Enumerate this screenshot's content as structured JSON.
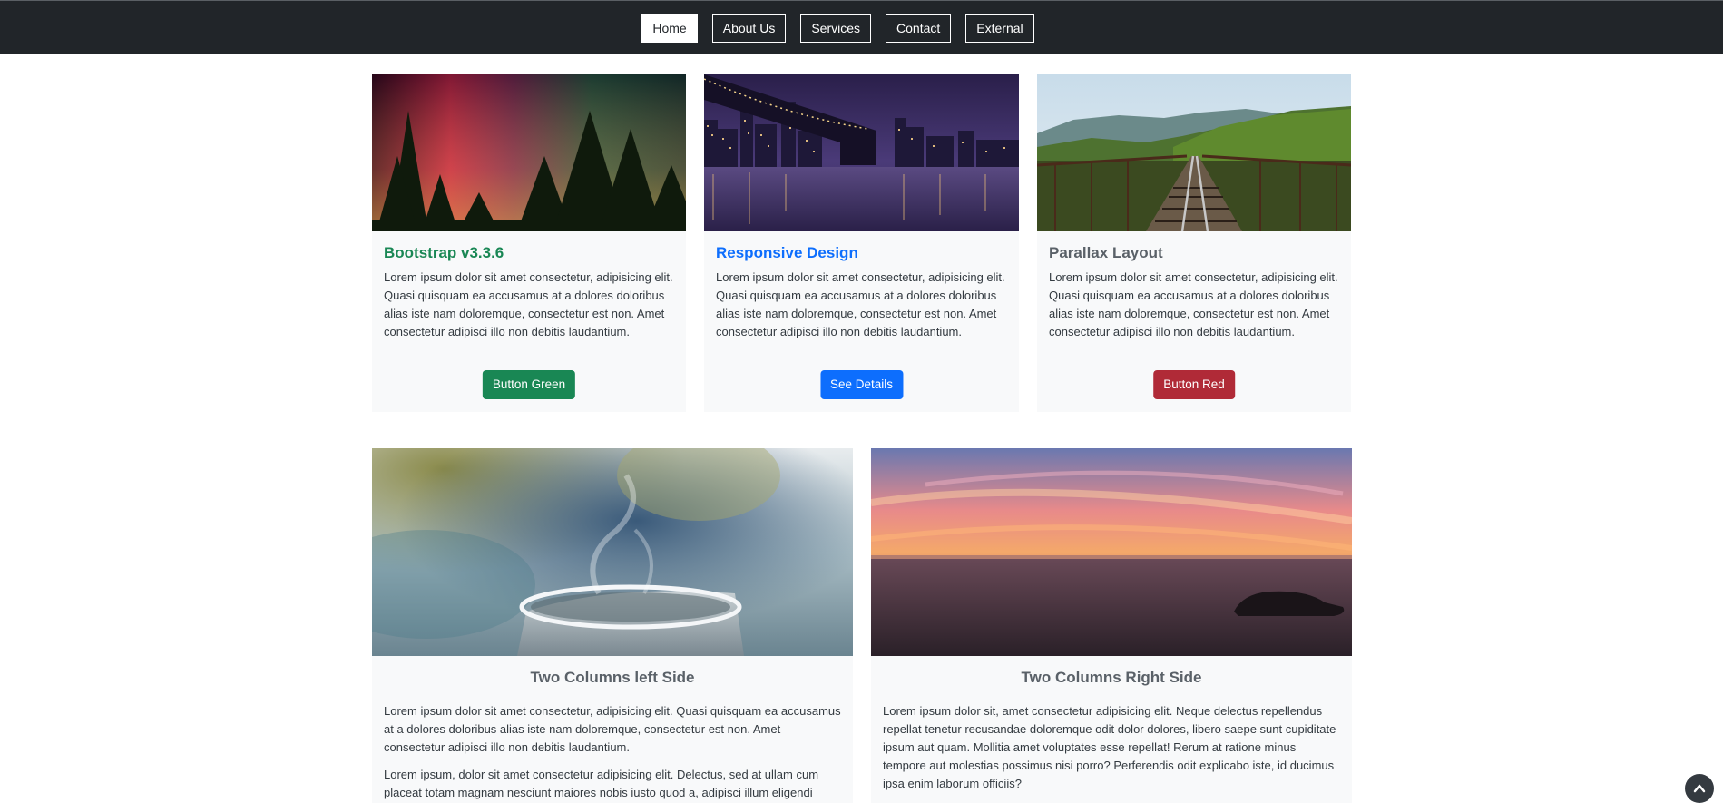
{
  "nav": {
    "items": [
      {
        "label": "Home",
        "active": true
      },
      {
        "label": "About Us"
      },
      {
        "label": "Services"
      },
      {
        "label": "Contact"
      },
      {
        "label": "External"
      }
    ]
  },
  "cards": [
    {
      "title": "Bootstrap v3.3.6",
      "title_color": "#198754",
      "text": "Lorem ipsum dolor sit amet consectetur, adipisicing elit. Quasi quisquam ea accusamus at a dolores doloribus alias iste nam doloremque, consectetur est non. Amet consectetur adipisci illo non debitis laudantium.",
      "button": "Button Green",
      "button_color": "#198754"
    },
    {
      "title": "Responsive Design",
      "title_color": "#0d6efd",
      "text": "Lorem ipsum dolor sit amet consectetur, adipisicing elit. Quasi quisquam ea accusamus at a dolores doloribus alias iste nam doloremque, consectetur est non. Amet consectetur adipisci illo non debitis laudantium.",
      "button": "See Details",
      "button_color": "#0d6efd"
    },
    {
      "title": "Parallax Layout",
      "title_color": "#5a6168",
      "text": "Lorem ipsum dolor sit amet consectetur, adipisicing elit. Quasi quisquam ea accusamus at a dolores doloribus alias iste nam doloremque, consectetur est non. Amet consectetur adipisci illo non debitis laudantium.",
      "button": "Button Red",
      "button_color": "#b02a37"
    }
  ],
  "wide_cards": [
    {
      "title": "Two Columns left Side",
      "paragraphs": [
        "Lorem ipsum dolor sit amet consectetur, adipisicing elit. Quasi quisquam ea accusamus at a dolores doloribus alias iste nam doloremque, consectetur est non. Amet consectetur adipisci illo non debitis laudantium.",
        "Lorem ipsum, dolor sit amet consectetur adipisicing elit. Delectus, sed at ullam cum placeat totam magnam nesciunt maiores nobis iusto quod a, adipisci illum eligendi"
      ]
    },
    {
      "title": "Two Columns Right Side",
      "paragraphs": [
        "Lorem ipsum dolor sit, amet consectetur adipisicing elit. Neque delectus repellendus repellat tenetur recusandae doloremque odit dolor dolores, libero saepe sunt cupiditate ipsum aut quam. Mollitia amet voluptates esse repellat! Rerum at ratione minus tempore aut molestias possimus nisi porro? Perferendis odit explicabo iste, id ducimus ipsa enim laborum officiis?"
      ]
    }
  ],
  "scroll_top_icon": "chevron-up-icon"
}
